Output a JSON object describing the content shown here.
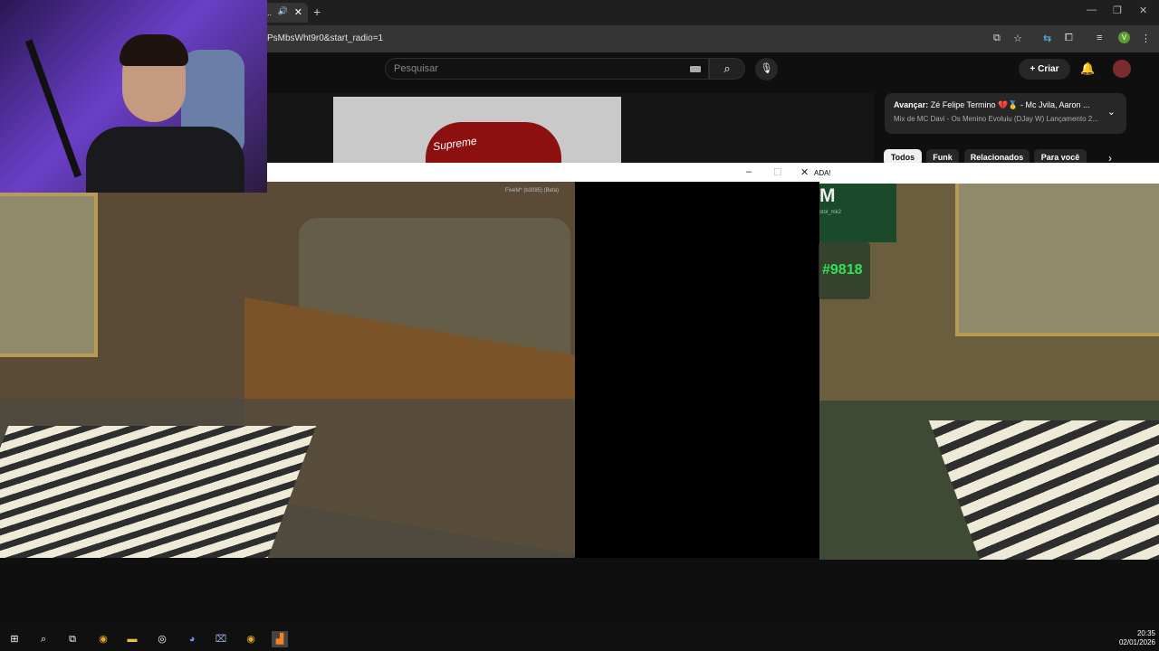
{
  "browser": {
    "tab_title": "pl..",
    "url": "PsMbsWht9r0&start_radio=1",
    "new_tab": "+",
    "profile_initial": "V"
  },
  "youtube": {
    "search_placeholder": "Pesquisar",
    "create_label": "Criar",
    "video_logo": "Supreme",
    "up_next": {
      "prefix": "Avançar:",
      "title": "Zé Felipe Termino 💔🥇 - Mc Jvila, Aaron ...",
      "mix": "Mix de MC Davi - Os Menino Evoluiu (DJay W) Lançamento 2..."
    },
    "chips": [
      "Todos",
      "Funk",
      "Relacionados",
      "Para você"
    ]
  },
  "game": {
    "strip_text": "ADA!",
    "big_letter": "M",
    "sub_text": "stol_mk2",
    "id_label": "#9818",
    "fivem_label": "FiveM* (b3095) (Beta)"
  },
  "taskbar": {
    "time": "20:35",
    "date": "02/01/2026"
  },
  "colors": {
    "accent_green": "#33e05b",
    "yt_bg": "#0f0f0f"
  }
}
